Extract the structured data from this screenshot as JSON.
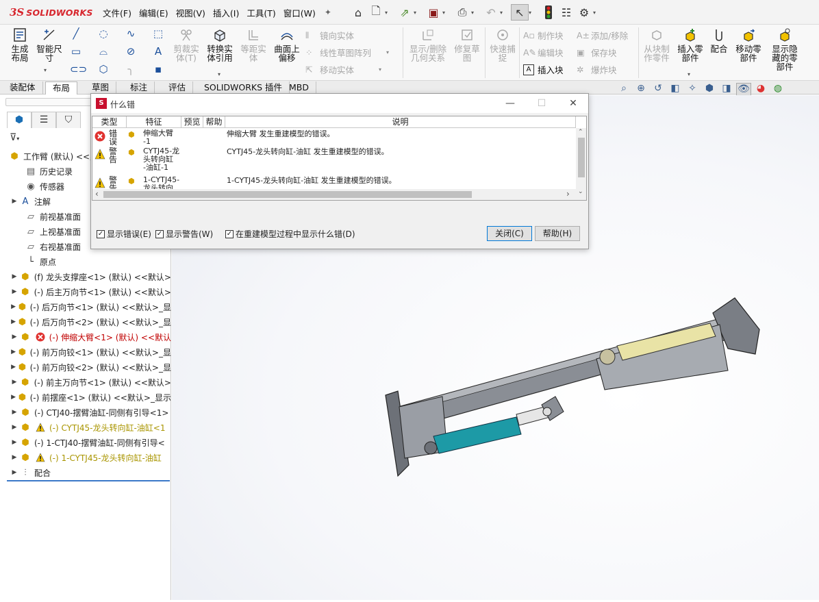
{
  "app": {
    "logo_ds": "3S",
    "logo_name": "SOLIDWORKS"
  },
  "menu": [
    "文件(F)",
    "编辑(E)",
    "视图(V)",
    "插入(I)",
    "工具(T)",
    "窗口(W)"
  ],
  "ribbon": {
    "big": [
      {
        "label": "生成\n布局",
        "icon": "layout-icon",
        "disabled": false
      },
      {
        "label": "智能尺\n寸",
        "icon": "smart-dimension-icon",
        "disabled": false
      },
      {
        "label": "剪裁实\n体(T)",
        "icon": "trim-icon",
        "disabled": true
      },
      {
        "label": "转换实\n体引用",
        "icon": "convert-entities-icon",
        "disabled": false
      },
      {
        "label": "等距实\n体",
        "icon": "offset-entities-icon",
        "disabled": true
      },
      {
        "label": "曲面上\n偏移",
        "icon": "offset-surface-icon",
        "disabled": false
      },
      {
        "label": "显示/删除\n几何关系",
        "icon": "relations-icon",
        "disabled": true
      },
      {
        "label": "修复草\n图",
        "icon": "repair-sketch-icon",
        "disabled": true
      },
      {
        "label": "快速捕\n捉",
        "icon": "quick-snap-icon",
        "disabled": true
      },
      {
        "label": "从块制\n作零件",
        "icon": "part-from-block-icon",
        "disabled": true
      },
      {
        "label": "插入零\n部件",
        "icon": "insert-component-icon",
        "disabled": false
      },
      {
        "label": "配合",
        "icon": "mate-icon",
        "disabled": false
      },
      {
        "label": "移动零\n部件",
        "icon": "move-component-icon",
        "disabled": false
      },
      {
        "label": "显示隐\n藏的零\n部件",
        "icon": "show-hidden-icon",
        "disabled": false
      }
    ],
    "small": [
      {
        "label": "镜向实体",
        "disabled": true
      },
      {
        "label": "线性草图阵列",
        "disabled": true
      },
      {
        "label": "移动实体",
        "disabled": true
      },
      {
        "label": "制作块",
        "disabled": true
      },
      {
        "label": "编辑块",
        "disabled": true
      },
      {
        "label": "插入块",
        "disabled": false
      },
      {
        "label": "添加/移除",
        "disabled": true
      },
      {
        "label": "保存块",
        "disabled": true
      },
      {
        "label": "爆炸块",
        "disabled": true
      }
    ]
  },
  "tabs": [
    "装配体",
    "布局",
    "草图",
    "标注",
    "评估",
    "SOLIDWORKS 插件",
    "MBD"
  ],
  "tree": {
    "root": "工作臂 (默认) <<默",
    "items": [
      {
        "label": "历史记录",
        "icon": "history-icon",
        "arrow": false,
        "status": ""
      },
      {
        "label": "传感器",
        "icon": "sensor-icon",
        "arrow": false,
        "status": ""
      },
      {
        "label": "注解",
        "icon": "annotation-icon",
        "arrow": true,
        "status": ""
      },
      {
        "label": "前视基准面",
        "icon": "plane-icon",
        "arrow": false,
        "status": ""
      },
      {
        "label": "上视基准面",
        "icon": "plane-icon",
        "arrow": false,
        "status": ""
      },
      {
        "label": "右视基准面",
        "icon": "plane-icon",
        "arrow": false,
        "status": ""
      },
      {
        "label": "原点",
        "icon": "origin-icon",
        "arrow": false,
        "status": ""
      },
      {
        "label": "(f) 龙头支撑座<1> (默认) <<默认>",
        "icon": "part-icon",
        "arrow": true,
        "status": ""
      },
      {
        "label": "(-) 后主万向节<1> (默认) <<默认>",
        "icon": "part-icon",
        "arrow": true,
        "status": ""
      },
      {
        "label": "(-) 后万向节<1> (默认) <<默认>_显",
        "icon": "part-icon",
        "arrow": true,
        "status": ""
      },
      {
        "label": "(-) 后万向节<2> (默认) <<默认>_显",
        "icon": "part-icon",
        "arrow": true,
        "status": ""
      },
      {
        "label": "(-) 伸缩大臂<1> (默认) <<默认",
        "icon": "assembly-icon",
        "arrow": true,
        "status": "error"
      },
      {
        "label": "(-) 前万向铰<1> (默认) <<默认>_显",
        "icon": "part-icon",
        "arrow": true,
        "status": ""
      },
      {
        "label": "(-) 前万向铰<2> (默认) <<默认>_显",
        "icon": "part-icon",
        "arrow": true,
        "status": ""
      },
      {
        "label": "(-) 前主万向节<1> (默认) <<默认>",
        "icon": "part-icon",
        "arrow": true,
        "status": ""
      },
      {
        "label": "(-) 前摆座<1> (默认) <<默认>_显示",
        "icon": "part-icon",
        "arrow": true,
        "status": ""
      },
      {
        "label": "(-) CTJ40-摆臂油缸-同侧有引导<1>",
        "icon": "subassembly-icon",
        "arrow": true,
        "status": ""
      },
      {
        "label": "(-) CYTJ45-龙头转向缸-油缸<1",
        "icon": "subassembly-icon",
        "arrow": true,
        "status": "warning"
      },
      {
        "label": "(-) 1-CTJ40-摆臂油缸-同侧有引导<",
        "icon": "subassembly-icon",
        "arrow": true,
        "status": ""
      },
      {
        "label": "(-) 1-CYTJ45-龙头转向缸-油缸",
        "icon": "subassembly-icon",
        "arrow": true,
        "status": "warning"
      },
      {
        "label": "配合",
        "icon": "mates-icon",
        "arrow": true,
        "status": ""
      }
    ]
  },
  "dialog": {
    "title": "什么错",
    "columns": [
      "类型",
      "特征",
      "预览",
      "帮助",
      "说明"
    ],
    "rows": [
      {
        "type": "错\n误",
        "status": "error",
        "feature": "伸缩大臂\n-1",
        "description": "伸缩大臂 发生重建模型的错误。"
      },
      {
        "type": "警\n告",
        "status": "warning",
        "feature": "CYTJ45-龙\n头转向缸\n-油缸-1",
        "description": "CYTJ45-龙头转向缸-油缸 发生重建模型的错误。"
      },
      {
        "type": "警\n告",
        "status": "warning",
        "feature": "1-CYTJ45-\n龙头转向\n缸-油缸-1",
        "description": "1-CYTJ45-龙头转向缸-油缸 发生重建模型的错误。"
      }
    ],
    "checkboxes": [
      "显示错误(E)",
      "显示警告(W)",
      "在重建模型过程中显示什么错(D)"
    ],
    "buttons": {
      "close": "关闭(C)",
      "help": "帮助(H)"
    }
  },
  "colors": {
    "error": "#e0322f",
    "warning": "#f2c200",
    "cylinder_teal": "#1d9aa6",
    "cylinder_yellow": "#e9e3a6",
    "frame_gray": "#7b7f86",
    "accent": "#3a78c8"
  }
}
